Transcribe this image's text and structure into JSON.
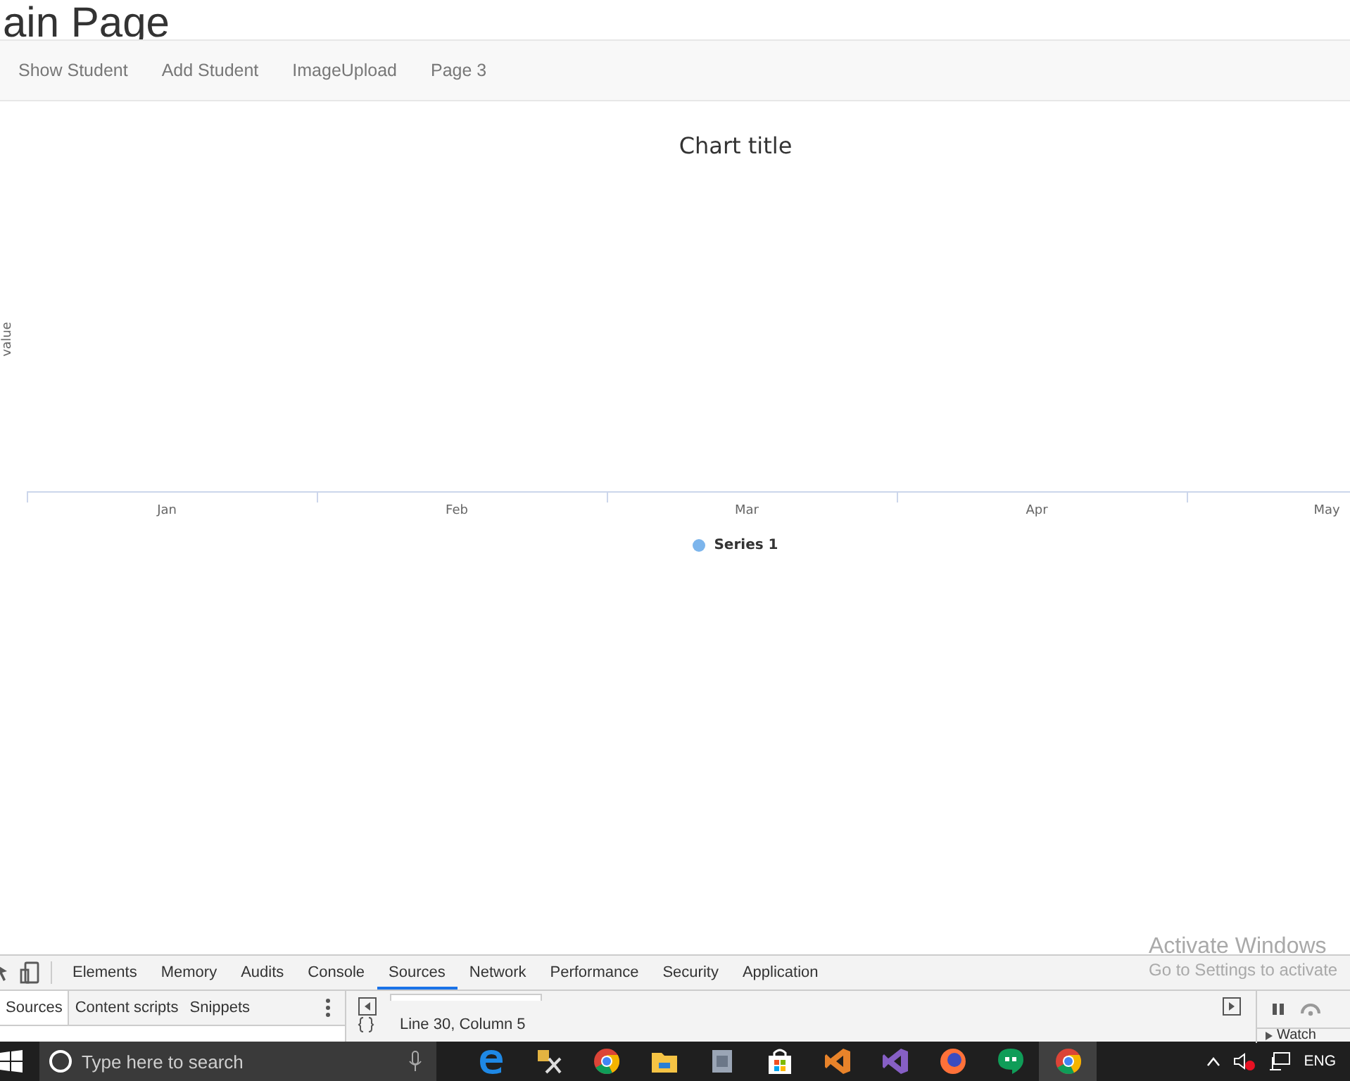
{
  "page_title": "ain Page",
  "nav": {
    "items": [
      {
        "label": "Show Student"
      },
      {
        "label": "Add Student"
      },
      {
        "label": "ImageUpload"
      },
      {
        "label": "Page 3"
      }
    ]
  },
  "chart": {
    "title": "Chart title",
    "ylabel": "value",
    "categories": [
      "Jan",
      "Feb",
      "Mar",
      "Apr",
      "May"
    ],
    "legend": [
      {
        "name": "Series 1",
        "color": "#7cb5ec"
      }
    ]
  },
  "devtools": {
    "tabs": [
      {
        "label": "Elements",
        "selected": false
      },
      {
        "label": "Memory",
        "selected": false
      },
      {
        "label": "Audits",
        "selected": false
      },
      {
        "label": "Console",
        "selected": false
      },
      {
        "label": "Sources",
        "selected": true
      },
      {
        "label": "Network",
        "selected": false
      },
      {
        "label": "Performance",
        "selected": false
      },
      {
        "label": "Security",
        "selected": false
      },
      {
        "label": "Application",
        "selected": false
      }
    ],
    "sub_tabs": [
      {
        "label": "Sources",
        "selected": true
      },
      {
        "label": "Content scripts",
        "selected": false
      },
      {
        "label": "Snippets",
        "selected": false
      }
    ],
    "status": "Line 30, Column 5",
    "watch_label": "Watch"
  },
  "activation": {
    "title": "Activate Windows",
    "subtitle": "Go to Settings to activate"
  },
  "taskbar": {
    "search_placeholder": "Type here to search",
    "language": "ENG"
  }
}
